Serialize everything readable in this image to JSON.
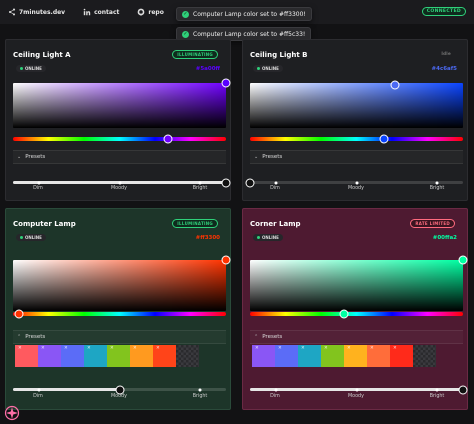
{
  "topbar": {
    "links": [
      {
        "label": "7minutes.dev",
        "icon": "share-icon"
      },
      {
        "label": "contact",
        "icon": "linkedin-icon"
      },
      {
        "label": "repo",
        "icon": "github-icon"
      }
    ],
    "status": "CONNECTED"
  },
  "toasts": [
    {
      "message": "Computer Lamp color set to #ff3300!"
    },
    {
      "message": "Computer Lamp color set to #ff5c33!"
    }
  ],
  "lights": [
    {
      "name": "Ceiling Light A",
      "state": "ILLUMINATING",
      "online": "ONLINE",
      "hex": "#5a00ff",
      "hue_color": "#7000ff",
      "presets_label": "Presets",
      "brightness_level": 1.0,
      "brightness_labels": [
        "Dim",
        "Moody",
        "Bright"
      ]
    },
    {
      "name": "Ceiling Light B",
      "state": "Idle",
      "online": "ONLINE",
      "hex": "#4c6af5",
      "hue_color": "#0a44ff",
      "presets_label": "Presets",
      "brightness_level": 0.0,
      "brightness_labels": [
        "Dim",
        "Moody",
        "Bright"
      ]
    },
    {
      "name": "Computer Lamp",
      "state": "ILLUMINATING",
      "online": "ONLINE",
      "hex": "#ff3300",
      "hue_color": "#ff3300",
      "presets_label": "Presets",
      "brightness_level": 0.5,
      "brightness_labels": [
        "Dim",
        "Moody",
        "Bright"
      ],
      "swatches": [
        "#ff5a5f",
        "#8a56f5",
        "#5b6cf7",
        "#1ea6c4",
        "#82c41e",
        "#ff9a1f",
        "#ff4419"
      ]
    },
    {
      "name": "Corner Lamp",
      "state": "RATE LIMITED",
      "online": "ONLINE",
      "hex": "#00ffa2",
      "hue_color": "#00ffa2",
      "presets_label": "Presets",
      "brightness_level": 1.0,
      "brightness_labels": [
        "Dim",
        "Moody",
        "Bright"
      ],
      "swatches": [
        "#8a56f5",
        "#5b6cf7",
        "#1ea6c4",
        "#82c41e",
        "#ffb21e",
        "#ff6d3a",
        "#ff2a1a"
      ]
    }
  ]
}
